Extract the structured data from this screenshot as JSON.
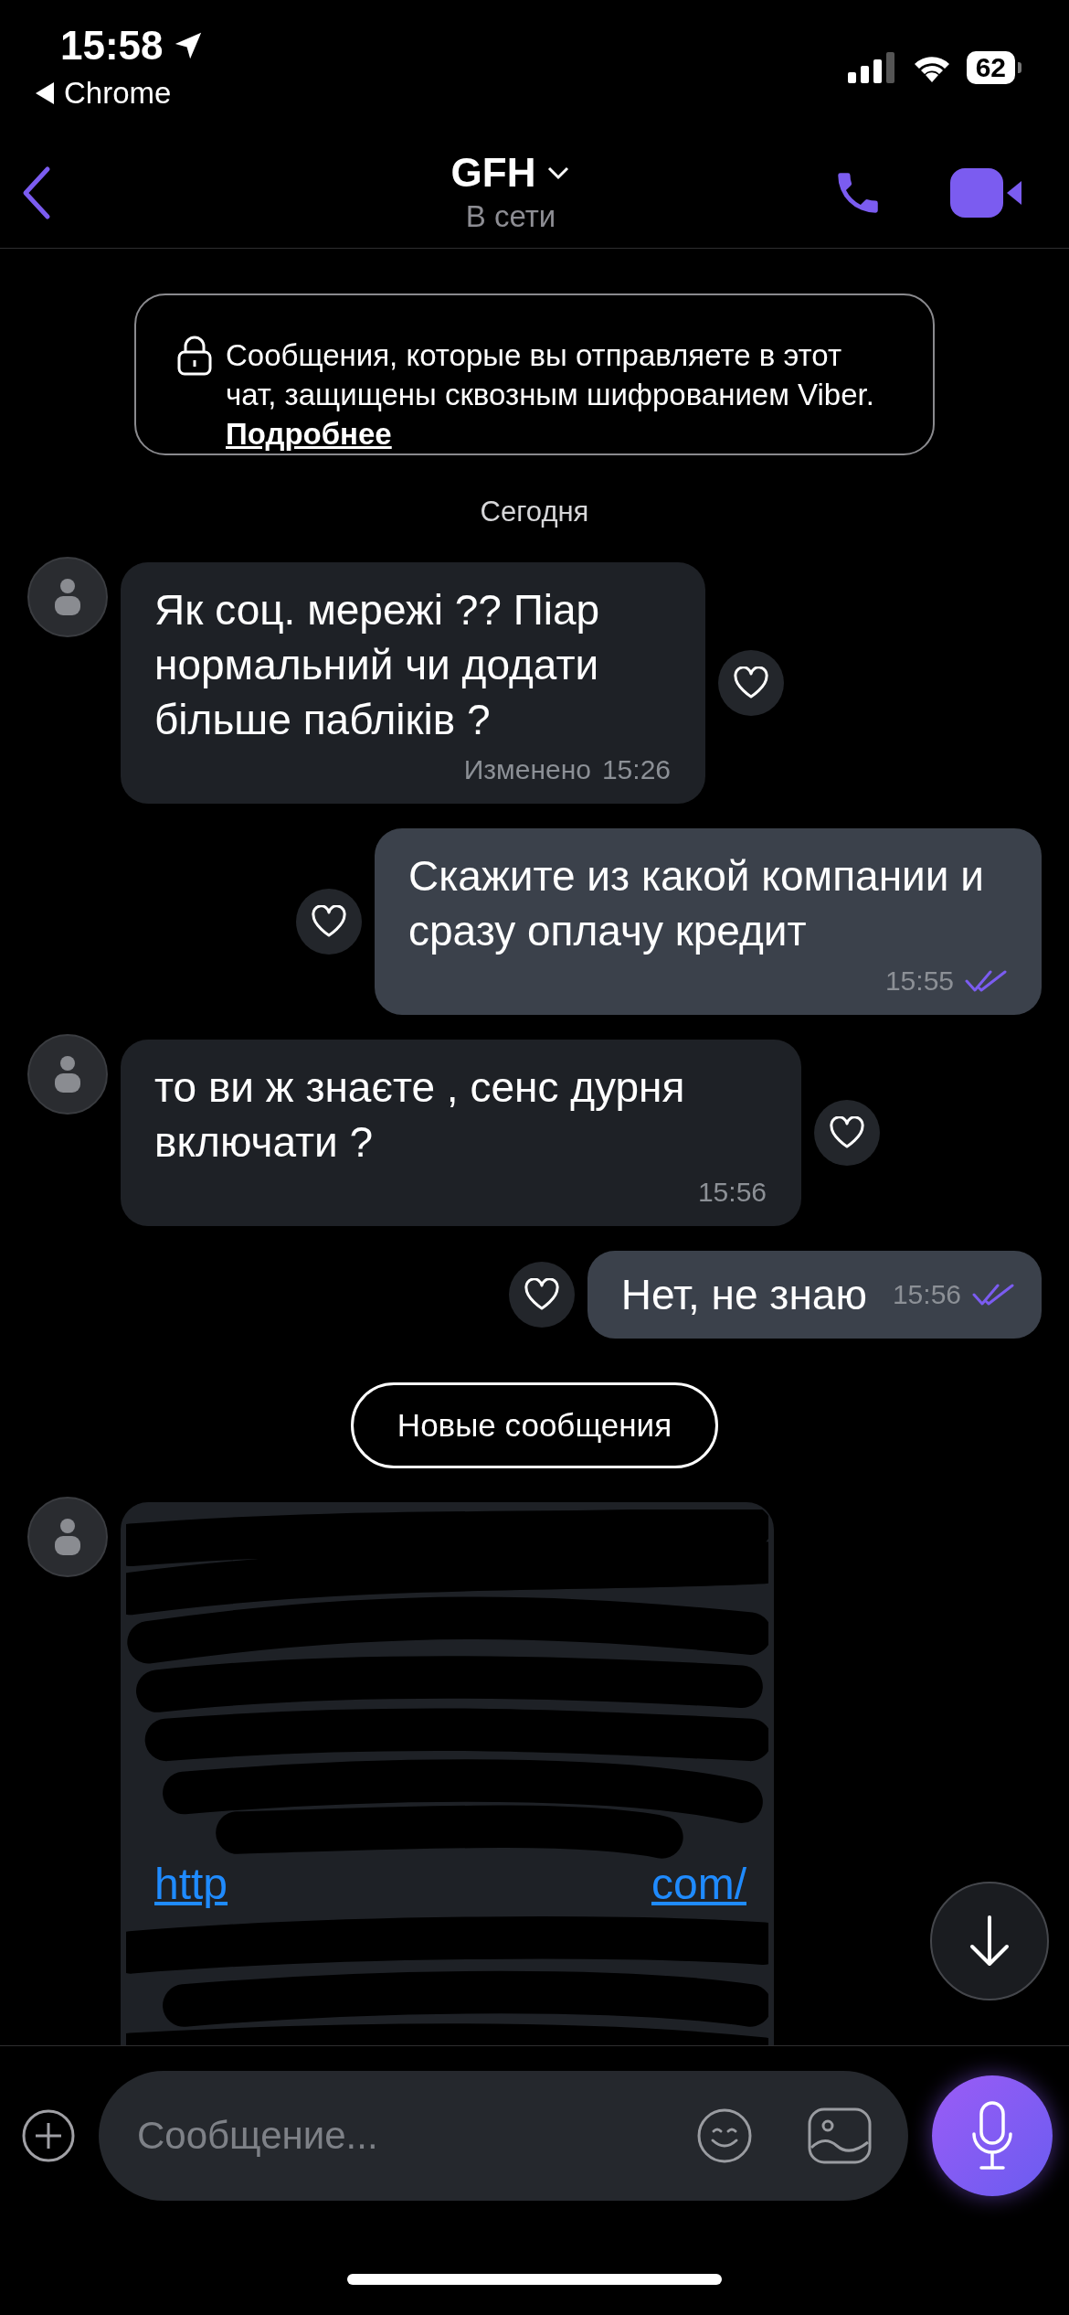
{
  "status_bar": {
    "time": "15:58",
    "back_app": "Chrome",
    "battery": "62"
  },
  "header": {
    "title": "GFH",
    "status": "В сети"
  },
  "encryption_notice": {
    "text": "Сообщения, которые вы отправляете в этот чат, защищены сквозным шифрованием Viber.",
    "link": "Подробнее"
  },
  "date_divider": "Сегодня",
  "messages": [
    {
      "kind": "incoming",
      "text": "Як соц. мережі ?? Піар нормальний чи додати більше пабліків ?",
      "edited": "Изменено",
      "time": "15:26"
    },
    {
      "kind": "outgoing",
      "text": "Скажите из какой компании и сразу оплачу кредит",
      "time": "15:55",
      "read": true
    },
    {
      "kind": "incoming",
      "text": "то ви ж знаєте , сенс дурня включати ?",
      "time": "15:56"
    },
    {
      "kind": "outgoing",
      "text": "Нет, не знаю",
      "time": "15:56",
      "read": true
    },
    {
      "kind": "new_divider",
      "label": "Новые сообщения"
    },
    {
      "kind": "redacted",
      "fragments": [
        "http",
        "com/"
      ]
    }
  ],
  "composer": {
    "placeholder": "Сообщение..."
  }
}
